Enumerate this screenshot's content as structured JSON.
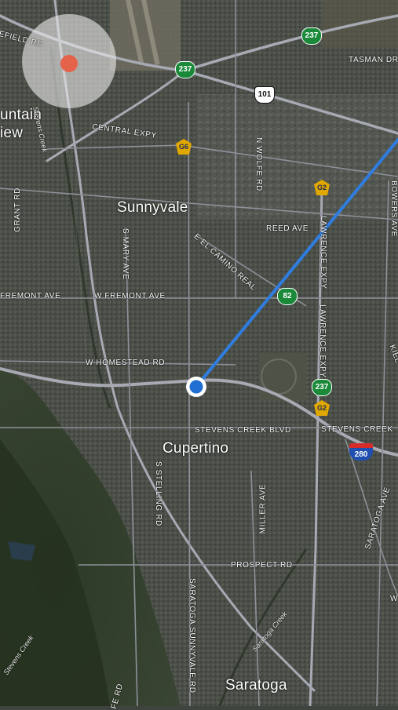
{
  "map": {
    "cities": [
      {
        "id": "mountain-view-line1",
        "text": "untain"
      },
      {
        "id": "mountain-view-line2",
        "text": "iew"
      },
      {
        "id": "sunnyvale",
        "text": "Sunnyvale"
      },
      {
        "id": "cupertino",
        "text": "Cupertino"
      },
      {
        "id": "saratoga",
        "text": "Saratoga"
      }
    ],
    "streets": {
      "fremont_west": "FREMONT AVE",
      "w_fremont": "W FREMONT AVE",
      "w_homestead": "W HOMESTEAD RD",
      "stevens_creek_blvd": "STEVENS CREEK BLVD",
      "stevens_creek_right": "STEVENS CREEK",
      "prospect": "PROSPECT RD",
      "reed": "REED AVE",
      "tasman": "TASMAN DR",
      "central_expy": "CENTRAL EXPY",
      "el_camino": "E EL CAMINO REAL",
      "n_wolfe": "N WOLFE RD",
      "s_mary": "S MARY AVE",
      "grant": "GRANT RD",
      "lawrence_top": "LAWRENCE EXPY",
      "lawrence_bottom": "LAWRENCE EXPY",
      "bowers": "BOWERS AVE",
      "miller": "MILLER AVE",
      "s_stelling": "S STELLING RD",
      "saratoga_sunnyvale": "SARATOGA SUNNYVALE RD",
      "saratoga_ave": "SARATOGA AVE",
      "field_rd": "EFIELD RD",
      "kiel": "KIEL",
      "w_edge": "W",
      "fe_rd": "FE RD"
    },
    "creeks": {
      "stevens_creek_top": "Stevens Creek",
      "stevens_creek_bottom": "Stevens Creek",
      "saratoga_creek": "Saratoga Creek"
    },
    "shields": [
      {
        "id": "shield-237-top",
        "type": "state",
        "text": "237"
      },
      {
        "id": "shield-237-left",
        "type": "state",
        "text": "237"
      },
      {
        "id": "shield-101",
        "type": "us",
        "text": "101"
      },
      {
        "id": "shield-g6",
        "type": "county",
        "text": "G6"
      },
      {
        "id": "shield-g2-top",
        "type": "county",
        "text": "G2"
      },
      {
        "id": "shield-82",
        "type": "state",
        "text": "82"
      },
      {
        "id": "shield-237-right",
        "type": "state",
        "text": "237"
      },
      {
        "id": "shield-g2-bottom",
        "type": "county",
        "text": "G2"
      },
      {
        "id": "shield-280",
        "type": "interstate",
        "text": "280"
      }
    ],
    "colors": {
      "route_line": "#2f7de0",
      "current_location": "#1f6fd1",
      "target_dot": "#e5624b",
      "state_shield": "#1a8a3a",
      "county_shield": "#e0a800",
      "interstate_shield": "#1f4fb0"
    }
  }
}
